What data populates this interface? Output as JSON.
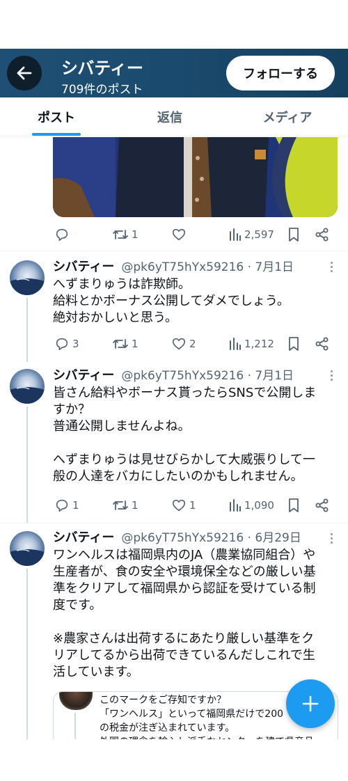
{
  "header": {
    "title": "シバティー",
    "post_count": "709件のポスト",
    "follow_label": "フォローする"
  },
  "tabs": [
    {
      "label": "ポスト",
      "active": true
    },
    {
      "label": "返信",
      "active": false
    },
    {
      "label": "メディア",
      "active": false
    }
  ],
  "colors": {
    "accent": "#1d9bf0",
    "header_bg": "#1a4a6d",
    "text_secondary": "#536471"
  },
  "top_post": {
    "reply_count": "",
    "repost_count": "1",
    "like_count": "",
    "view_count": "2,597"
  },
  "posts": [
    {
      "name": "シバティー",
      "handle_date": "@pk6yT75hYx59216 · 7月1日",
      "lines": [
        "へずまりゅうは詐欺師。",
        "給料とかボーナス公開してダメでしょう。",
        "絶対おかしいと思う。"
      ],
      "reply_count": "3",
      "repost_count": "1",
      "like_count": "2",
      "view_count": "1,212"
    },
    {
      "name": "シバティー",
      "handle_date": "@pk6yT75hYx59216 · 7月1日",
      "lines": [
        "皆さん給料やボーナス貰ったらSNSで公開しま",
        "すか？",
        "普通公開しませんよね。",
        "",
        "へずまりゅうは見せびらかして大威張りして一",
        "般の人達をバカにしたいのかもしれません。"
      ],
      "reply_count": "1",
      "repost_count": "1",
      "like_count": "1",
      "view_count": "1,090"
    },
    {
      "name": "シバティー",
      "handle_date": "@pk6yT75hYx59216 · 6月29日",
      "lines": [
        "ワンヘルスは福岡県内のJA（農業協同組合）や",
        "生産者が、食の安全や環境保全などの厳しい基",
        "準をクリアして福岡県から認証を受けている制",
        "度です。",
        "",
        "※農家さんは出荷するにあたり厳しい基準をク",
        "リアしてるから出荷できているんだしこれで生",
        "活しています。"
      ],
      "quote": {
        "lines": [
          "このマークをご存知ですか？",
          "「ワンヘルス」といって福岡県だけで200",
          "の税金が注ぎ込まれています。",
          "外国の理念を輸入し派手なセンターを建て県産品"
        ]
      }
    }
  ]
}
